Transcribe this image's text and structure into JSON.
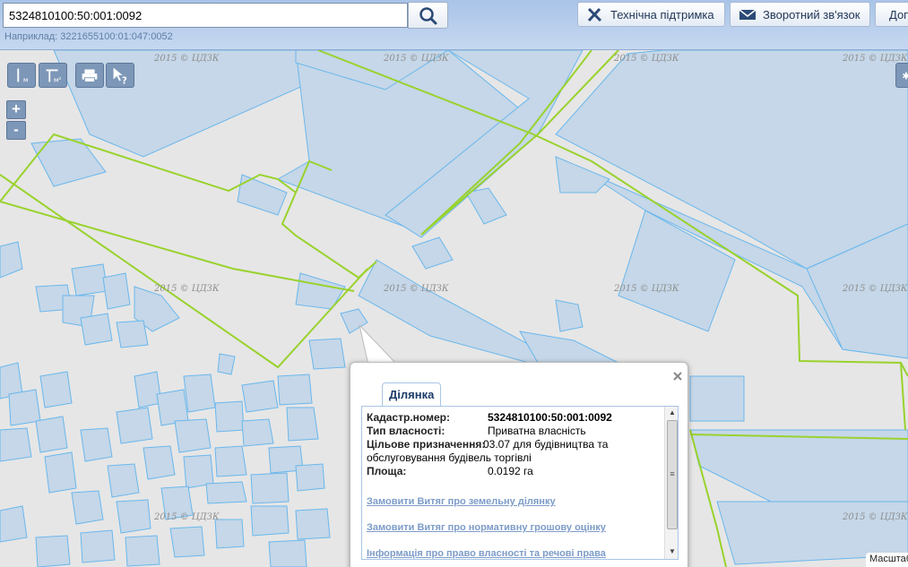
{
  "header": {
    "search_value": "5324810100:50:001:0092",
    "search_hint": "Наприклад: 3221655100:01:047:0052",
    "buttons": {
      "support": "Технічна підтримка",
      "feedback": "Зворотний зв'язок",
      "more": "Доп"
    }
  },
  "map": {
    "watermark": "2015 © ЦДЗК",
    "scale_label": "Масштаб",
    "colors": {
      "background": "#e6e6e6",
      "parcel_fill": "#c5d7e8",
      "parcel_stroke": "#6ab7ec",
      "boundary": "#99d22d"
    }
  },
  "tools": {
    "icons": [
      "measure-distance-icon",
      "measure-area-icon",
      "print-icon",
      "identify-icon"
    ],
    "zoom_in": "+",
    "zoom_out": "-"
  },
  "popup": {
    "tab": "Ділянка",
    "fields": [
      {
        "label": "Кадастр.номер:",
        "value": "5324810100:50:001:0092"
      },
      {
        "label": "Тип власності:",
        "value": "Приватна власність"
      },
      {
        "label": "Цільове призначення:",
        "value": "03.07 для будівництва та обслуговування будівель торгівлі"
      },
      {
        "label": "Площа:",
        "value": "0.0192 га"
      }
    ],
    "links": [
      "Замовити Витяг про земельну ділянку",
      "Замовити Витяг про нормативну грошову оцінку",
      "Інформація про право власності та речові права"
    ]
  }
}
